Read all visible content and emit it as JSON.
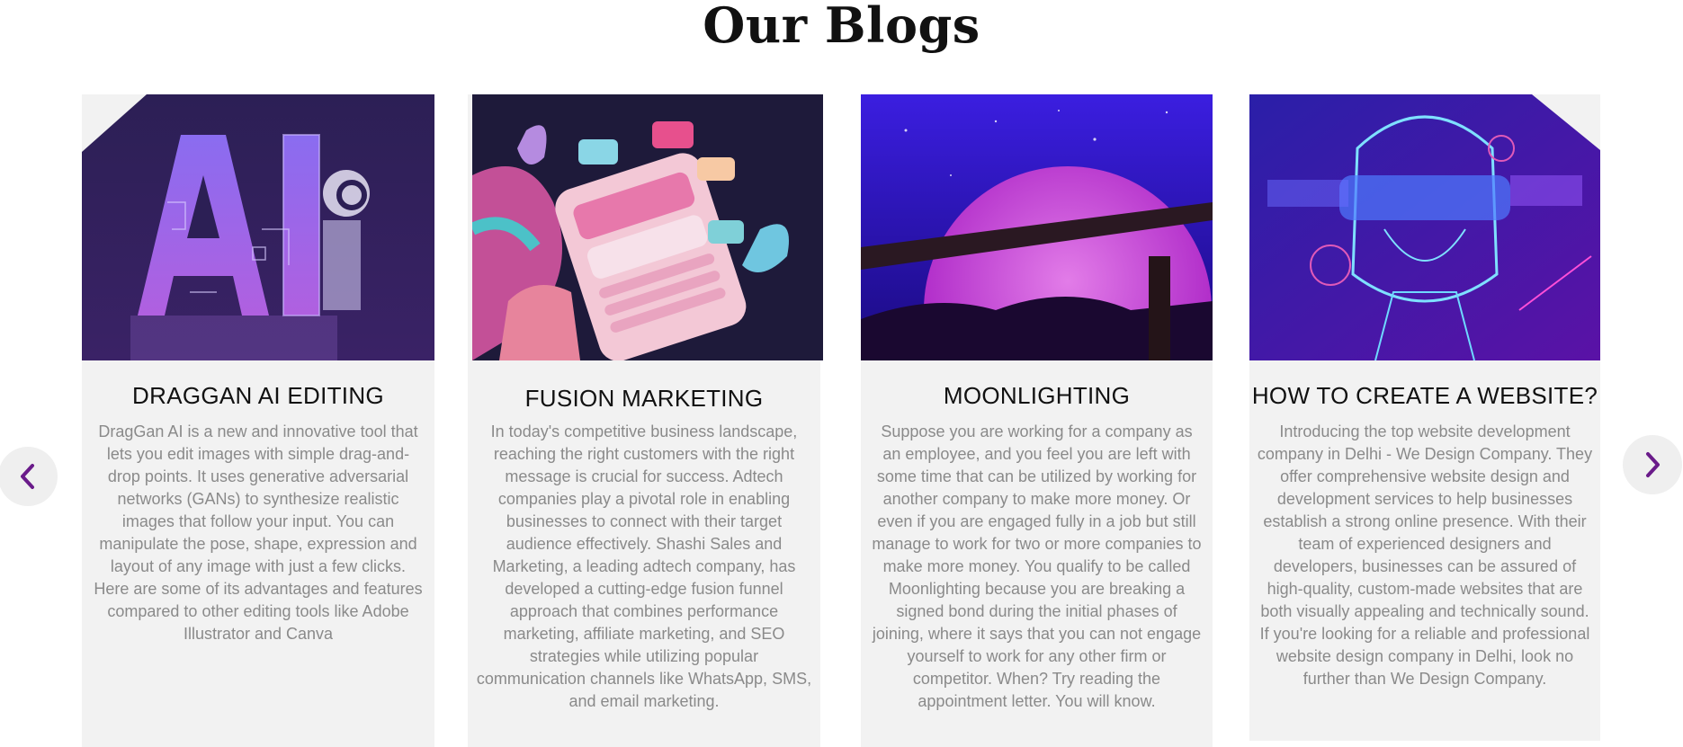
{
  "page": {
    "title": "Our Blogs"
  },
  "nav": {
    "prev_icon": "chevron-left-icon",
    "next_icon": "chevron-right-icon",
    "accent": "#6a1b8a"
  },
  "cards": [
    {
      "title": "DRAGGAN AI EDITING",
      "image": "ai-letters-robot-illustration",
      "text": "DragGan AI is a new and innovative tool that lets you edit images with simple drag-and-drop points. It uses generative adversarial networks (GANs) to synthesize realistic images that follow your input. You can manipulate the pose, shape, expression and layout of any image with just a few clicks. Here are some of its advantages and features compared to other editing tools like Adobe Illustrator and Canva"
    },
    {
      "title": "FUSION MARKETING",
      "image": "phone-chat-bubbles-illustration",
      "text": "In today's competitive business landscape, reaching the right customers with the right message is crucial for success. Adtech companies play a pivotal role in enabling businesses to connect with their target audience effectively. Shashi Sales and Marketing, a leading adtech company, has developed a cutting-edge fusion funnel approach that combines performance marketing, affiliate marketing, and SEO strategies while utilizing popular communication channels like WhatsApp, SMS, and email marketing."
    },
    {
      "title": "MOONLIGHTING",
      "image": "moon-fence-night-illustration",
      "text": "Suppose you are working for a company as an employee, and you feel you are left with some time that can be utilized by working for another company to make more money. Or even if you are engaged fully in a job but still manage to work for two or more companies to make more money. You qualify to be called Moonlighting because you are breaking a signed bond during the initial phases of joining, where it says that you can not engage yourself to work for any other firm or competitor. When? Try reading the appointment letter. You will know."
    },
    {
      "title": "HOW TO CREATE A WEBSITE?",
      "image": "vr-headset-face-illustration",
      "text": "Introducing the top website development company in Delhi - We Design Company. They offer comprehensive website design and development services to help businesses establish a strong online presence. With their team of experienced designers and developers, businesses can be assured of high-quality, custom-made websites that are both visually appealing and technically sound. If you're looking for a reliable and professional website design company in Delhi, look no further than We Design Company."
    }
  ]
}
